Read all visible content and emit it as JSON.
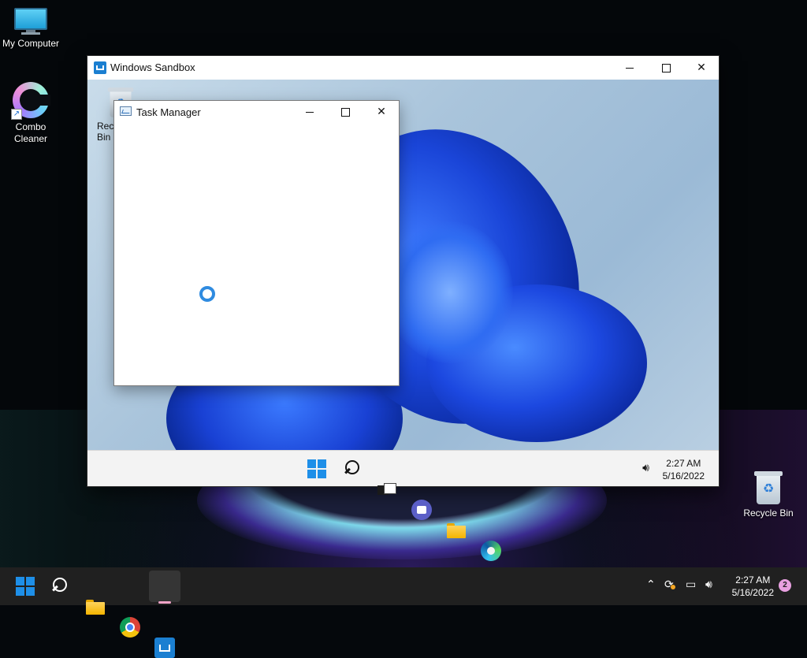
{
  "host_desktop": {
    "icons": [
      {
        "label": "My Computer",
        "icon": "monitor-icon"
      },
      {
        "label": "Combo\nCleaner",
        "icon": "combo-cleaner-icon"
      },
      {
        "label": "Recycle Bin",
        "icon": "recycle-bin-icon"
      }
    ]
  },
  "sandbox_window": {
    "title": "Windows Sandbox",
    "icon": "windows-sandbox-icon",
    "controls": {
      "minimize": "minimize",
      "maximize": "maximize",
      "close": "✕"
    },
    "desktop": {
      "recycle_bin_label": "Recycle Bin"
    },
    "taskbar": {
      "icons": [
        "start-icon",
        "search-icon",
        "task-view-icon",
        "teams-chat-icon",
        "file-explorer-icon",
        "edge-icon"
      ],
      "time": "2:27 AM",
      "date": "5/16/2022",
      "volume_icon": "volume-icon"
    }
  },
  "task_manager": {
    "title": "Task Manager",
    "icon": "task-manager-icon",
    "loading": true,
    "controls": {
      "close": "✕"
    }
  },
  "host_taskbar": {
    "icons": [
      "start-icon",
      "search-icon",
      "file-explorer-icon",
      "chrome-icon",
      "windows-sandbox-icon"
    ],
    "active": "windows-sandbox-icon",
    "tray_icons": [
      "chevron-up-icon",
      "sync-icon",
      "network-icon",
      "volume-icon"
    ],
    "time": "2:27 AM",
    "date": "5/16/2022",
    "notification_count": "2"
  },
  "colors": {
    "accent": "#1e8fe8",
    "sandbox_brand": "#1b7fd1",
    "taskbar_dark": "#202020",
    "taskbar_light": "#f3f3f3",
    "active_indicator": "#f0a3c8"
  }
}
